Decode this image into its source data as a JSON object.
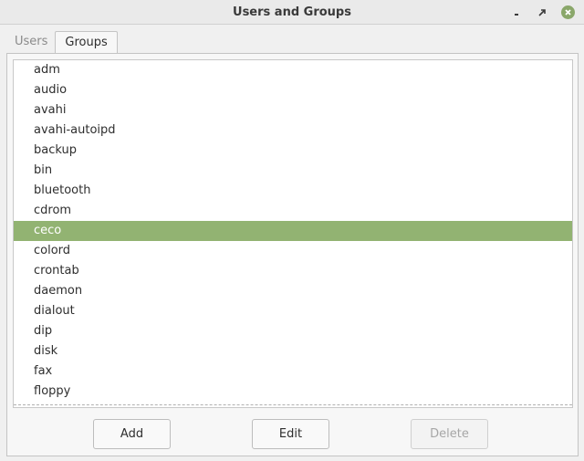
{
  "window": {
    "title": "Users and Groups"
  },
  "tabs": [
    {
      "label": "Users",
      "active": false
    },
    {
      "label": "Groups",
      "active": true
    }
  ],
  "groups": {
    "items": [
      "adm",
      "audio",
      "avahi",
      "avahi-autoipd",
      "backup",
      "bin",
      "bluetooth",
      "cdrom",
      "ceco",
      "colord",
      "crontab",
      "daemon",
      "dialout",
      "dip",
      "disk",
      "fax",
      "floppy"
    ],
    "selected": "ceco"
  },
  "buttons": {
    "add": "Add",
    "edit": "Edit",
    "delete": "Delete",
    "delete_enabled": false
  },
  "colors": {
    "selection": "#92b372",
    "close_button": "#8aa76a"
  },
  "icons": {
    "minimize": "minimize-icon",
    "maximize": "maximize-icon",
    "close": "close-icon"
  }
}
